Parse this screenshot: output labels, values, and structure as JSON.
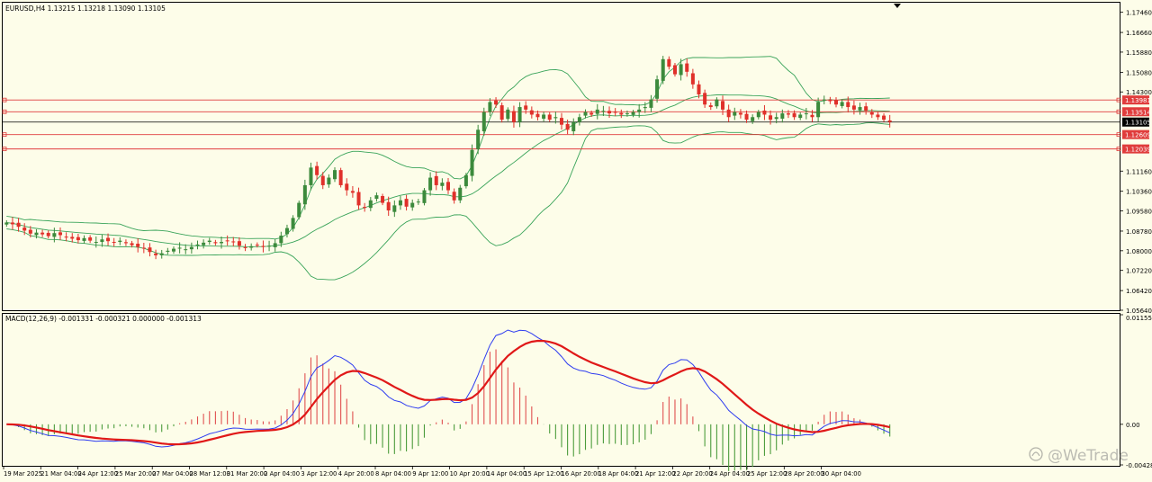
{
  "price_panel": {
    "header": "EURUSD,H4  1.13215 1.13218 1.13090 1.13105",
    "current_price_label": "1.13105",
    "level_labels": [
      "1.13981",
      "1.13514",
      "1.12609",
      "1.12039"
    ]
  },
  "macd_panel": {
    "header": "MACD(12,26,9) -0.001331 -0.000321 0.000000 -0.001313"
  },
  "watermark": {
    "text": "@WeTrade"
  },
  "colors": {
    "background": "#fdfde9",
    "bull_candle": "#3c8a3c",
    "bear_candle": "#e0302a",
    "bollinger": "#3aa45a",
    "level_line": "#e03c3c",
    "macd_line": "#2e3cf0",
    "signal_line": "#e01818",
    "hist_pos": "#e05050",
    "hist_neg": "#4c9c3c"
  },
  "chart_data": [
    {
      "type": "candlestick",
      "symbol": "EURUSD",
      "timeframe": "H4",
      "ohlc_current": {
        "open": 1.13215,
        "high": 1.13218,
        "low": 1.1309,
        "close": 1.13105
      },
      "ylim": [
        1.0564,
        1.1784
      ],
      "y_ticks": [
        "1.17460",
        "1.16660",
        "1.15880",
        "1.15080",
        "1.14300",
        "1.11160",
        "1.10360",
        "1.09580",
        "1.08780",
        "1.08000",
        "1.07220",
        "1.06420",
        "1.05640"
      ],
      "x_ticks": [
        "19 Mar 2025",
        "21 Mar 04:00",
        "24 Apr 12:00",
        "25 Mar 20:00",
        "27 Mar 04:00",
        "28 Mar 12:00",
        "31 Mar 20:00",
        "2 Apr 04:00",
        "3 Apr 12:00",
        "4 Apr 20:00",
        "8 Apr 04:00",
        "9 Apr 12:00",
        "10 Apr 20:00",
        "14 Apr 04:00",
        "15 Apr 12:00",
        "16 Apr 20:00",
        "18 Apr 04:00",
        "21 Apr 12:00",
        "22 Apr 20:00",
        "24 Apr 04:00",
        "25 Apr 12:00",
        "28 Apr 20:00",
        "30 Apr 04:00"
      ],
      "horizontal_levels": [
        1.13981,
        1.13514,
        1.12609,
        1.12039
      ],
      "current_price": 1.13105,
      "close_series": [
        1.0912,
        1.0905,
        1.0895,
        1.088,
        1.0868,
        1.0872,
        1.0865,
        1.0858,
        1.087,
        1.0862,
        1.0855,
        1.0848,
        1.0842,
        1.085,
        1.084,
        1.0835,
        1.0845,
        1.0838,
        1.0832,
        1.084,
        1.083,
        1.0822,
        1.0815,
        1.081,
        1.0795,
        1.0782,
        1.079,
        1.08,
        1.0808,
        1.0812,
        1.0806,
        1.0815,
        1.0825,
        1.0832,
        1.084,
        1.083,
        1.0835,
        1.084,
        1.0835,
        1.082,
        1.0812,
        1.0818,
        1.0822,
        1.0815,
        1.082,
        1.083,
        1.086,
        1.089,
        1.093,
        1.099,
        1.106,
        1.113,
        1.11,
        1.106,
        1.109,
        1.112,
        1.106,
        1.104,
        1.103,
        1.098,
        1.097,
        1.1,
        1.102,
        1.099,
        1.096,
        1.098,
        1.1,
        1.0975,
        1.099,
        1.0995,
        1.104,
        1.109,
        1.106,
        1.107,
        1.104,
        1.1,
        1.105,
        1.11,
        1.12,
        1.128,
        1.135,
        1.139,
        1.138,
        1.132,
        1.136,
        1.131,
        1.137,
        1.136,
        1.134,
        1.133,
        1.134,
        1.132,
        1.133,
        1.13,
        1.128,
        1.131,
        1.133,
        1.135,
        1.134,
        1.136,
        1.1355,
        1.1345,
        1.135,
        1.134,
        1.1345,
        1.135,
        1.136,
        1.137,
        1.14,
        1.148,
        1.156,
        1.153,
        1.15,
        1.154,
        1.151,
        1.146,
        1.142,
        1.138,
        1.137,
        1.14,
        1.136,
        1.133,
        1.135,
        1.134,
        1.132,
        1.133,
        1.135,
        1.134,
        1.132,
        1.133,
        1.1345,
        1.134,
        1.133,
        1.134,
        1.1345,
        1.133,
        1.139,
        1.14,
        1.1395,
        1.138,
        1.139,
        1.137,
        1.136,
        1.137,
        1.1355,
        1.134,
        1.133,
        1.132,
        1.13105
      ]
    },
    {
      "type": "line",
      "name": "MACD(12,26,9)",
      "values_current": {
        "macd": -0.001331,
        "signal": -0.000321,
        "zero": 0.0,
        "histogram": -0.001313
      },
      "ylim": [
        -0.004281,
        0.011553
      ],
      "y_ticks": [
        "0.011553",
        "0.00",
        "-0.004281"
      ]
    }
  ]
}
